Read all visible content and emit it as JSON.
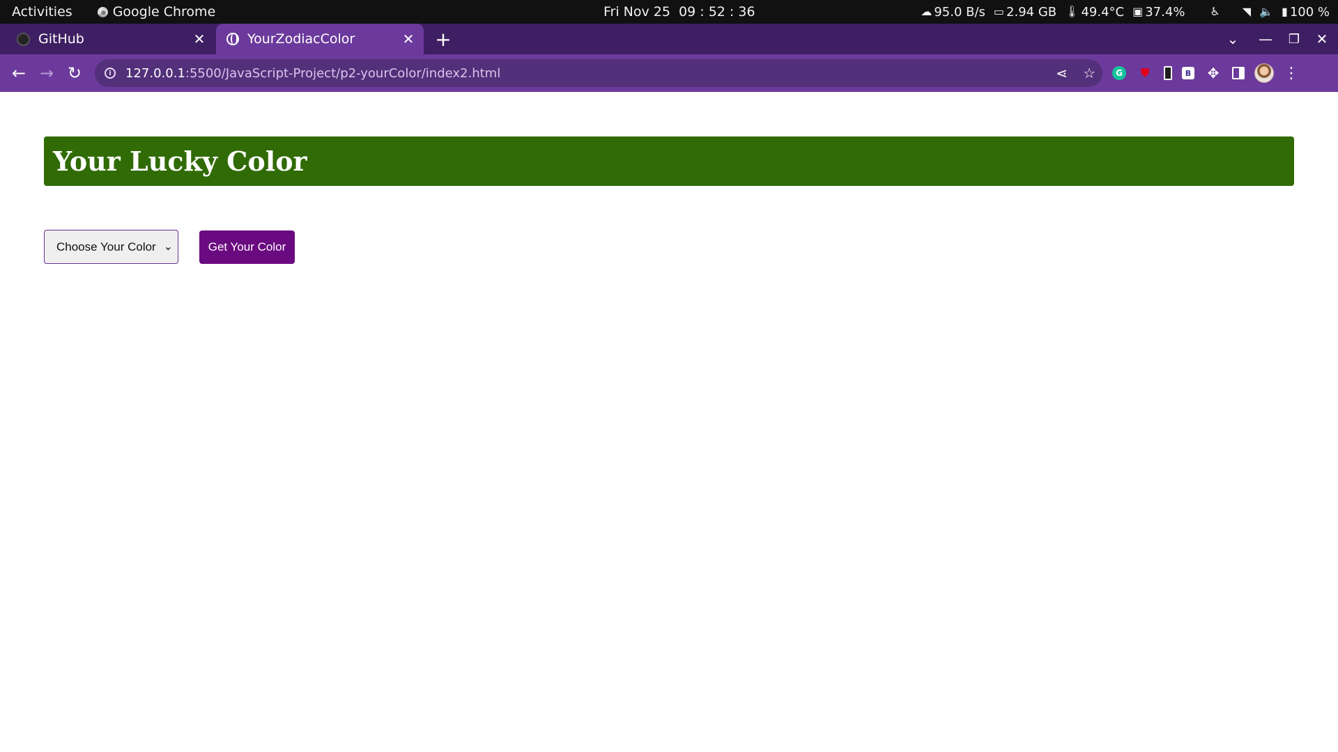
{
  "system_bar": {
    "activities": "Activities",
    "app_name": "Google Chrome",
    "clock": "Fri Nov 25  09 : 52 : 36",
    "net_speed": "95.0 B/s",
    "memory": "2.94 GB",
    "temperature": "49.4°C",
    "cpu": "37.4%",
    "battery": "100 %"
  },
  "tabs": [
    {
      "title": "GitHub",
      "icon": "github-icon"
    },
    {
      "title": "YourZodiacColor",
      "icon": "globe-icon"
    }
  ],
  "address_bar": {
    "host": "127.0.0.1",
    "rest": ":5500/JavaScript-Project/p2-yourColor/index2.html"
  },
  "page": {
    "heading": "Your Lucky Color",
    "select_value": "Choose Your Color",
    "button_label": "Get Your Color"
  },
  "colors": {
    "banner_bg": "#306b06",
    "button_bg": "#6a0a80",
    "tabstrip_bg": "#3f1f63",
    "toolbar_bg": "#6c3a9c"
  }
}
